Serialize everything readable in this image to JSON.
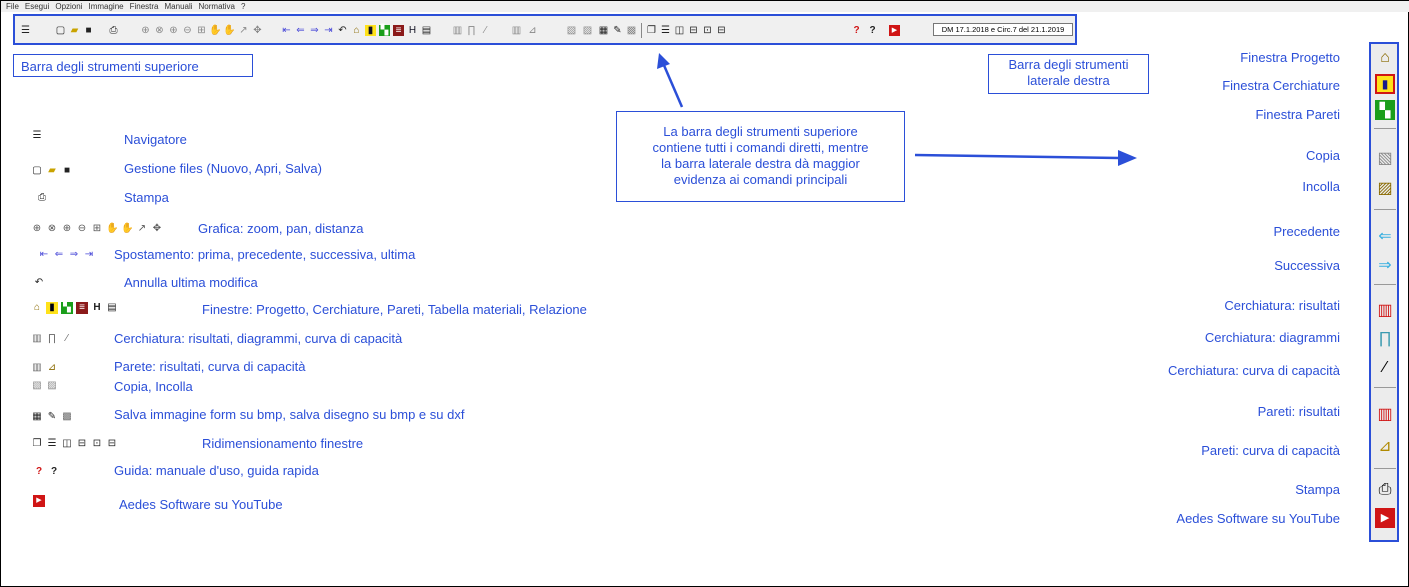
{
  "menu": [
    "File",
    "Esegui",
    "Opzioni",
    "Immagine",
    "Finestra",
    "Manuali",
    "Normativa",
    "?"
  ],
  "toolbar": {
    "norm_label": "DM 17.1.2018 e Circ.7 del 21.1.2019"
  },
  "labels": {
    "top_toolbar": "Barra degli strumenti superiore",
    "right_toolbar_line1": "Barra degli strumenti",
    "right_toolbar_line2": "laterale destra",
    "callout_line1": "La barra degli strumenti superiore",
    "callout_line2": "contiene tutti i comandi diretti, mentre",
    "callout_line3": "la barra laterale destra dà maggior",
    "callout_line4": "evidenza ai comandi principali"
  },
  "legend": [
    {
      "key": "navigator",
      "text": "Navigatore"
    },
    {
      "key": "files",
      "text": "Gestione files (Nuovo, Apri, Salva)"
    },
    {
      "key": "print",
      "text": "Stampa"
    },
    {
      "key": "graphics",
      "text": "Grafica: zoom, pan, distanza"
    },
    {
      "key": "navigation",
      "text": "Spostamento: prima, precedente, successiva, ultima"
    },
    {
      "key": "undo",
      "text": "Annulla ultima modifica"
    },
    {
      "key": "windows",
      "text": "Finestre: Progetto, Cerchiature, Pareti, Tabella materiali, Relazione"
    },
    {
      "key": "cerch",
      "text": "Cerchiatura: risultati, diagrammi, curva di capacità"
    },
    {
      "key": "parete",
      "text": "Parete: risultati, curva di capacità"
    },
    {
      "key": "copypaste",
      "text": "Copia, Incolla"
    },
    {
      "key": "saveimg",
      "text": "Salva immagine form su bmp, salva disegno su bmp e su dxf"
    },
    {
      "key": "resize",
      "text": "Ridimensionamento finestre"
    },
    {
      "key": "help",
      "text": "Guida: manuale d'uso, guida rapida"
    },
    {
      "key": "youtube",
      "text": "Aedes Software su YouTube"
    }
  ],
  "right_labels": [
    {
      "key": "progetto",
      "text": "Finestra Progetto"
    },
    {
      "key": "cerchiature",
      "text": "Finestra Cerchiature"
    },
    {
      "key": "pareti",
      "text": "Finestra Pareti"
    },
    {
      "key": "copia",
      "text": "Copia"
    },
    {
      "key": "incolla",
      "text": "Incolla"
    },
    {
      "key": "precedente",
      "text": "Precedente"
    },
    {
      "key": "successiva",
      "text": "Successiva"
    },
    {
      "key": "cerch_ris",
      "text": "Cerchiatura: risultati"
    },
    {
      "key": "cerch_diag",
      "text": "Cerchiatura: diagrammi"
    },
    {
      "key": "cerch_curva",
      "text": "Cerchiatura: curva di capacità"
    },
    {
      "key": "pareti_ris",
      "text": "Pareti: risultati"
    },
    {
      "key": "pareti_curva",
      "text": "Pareti: curva di capacità"
    },
    {
      "key": "stampa",
      "text": "Stampa"
    },
    {
      "key": "youtube",
      "text": "Aedes Software su YouTube"
    }
  ],
  "colors": {
    "accent": "#2b4fd8",
    "callout_arrow": "#2b4fd8"
  }
}
